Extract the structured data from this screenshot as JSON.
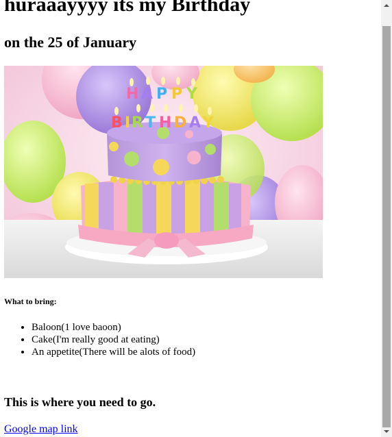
{
  "page": {
    "heading": "huraaayyyy its my Birthday",
    "subheading": "on the 25 of January"
  },
  "hero_image": {
    "cake_topper_letters": [
      "H",
      "A",
      "P",
      "P",
      "Y",
      "B",
      "I",
      "R",
      "T",
      "H",
      "D",
      "A",
      "Y"
    ],
    "colors": {
      "background_pink": "#f3c6d9",
      "balloon_purple": "#b59ae6",
      "balloon_yellow": "#f4ea6a",
      "balloon_green": "#c8ef6a",
      "cake_lilac": "#c7a6e6",
      "cake_pink_ribbon": "#f7b5cc",
      "plate_white": "#f4f4f4"
    }
  },
  "bring": {
    "title": "What to bring:",
    "items": [
      "Baloon(1 love baoon)",
      "Cake(I'm really good at eating)",
      "An appetite(There will be alots of food)"
    ]
  },
  "directions": {
    "title": "This is where you need to go.",
    "link_label": "Google map link"
  },
  "scrollbar": {
    "arrow_up_icon": "triangle-up",
    "arrow_down_icon": "triangle-down"
  }
}
